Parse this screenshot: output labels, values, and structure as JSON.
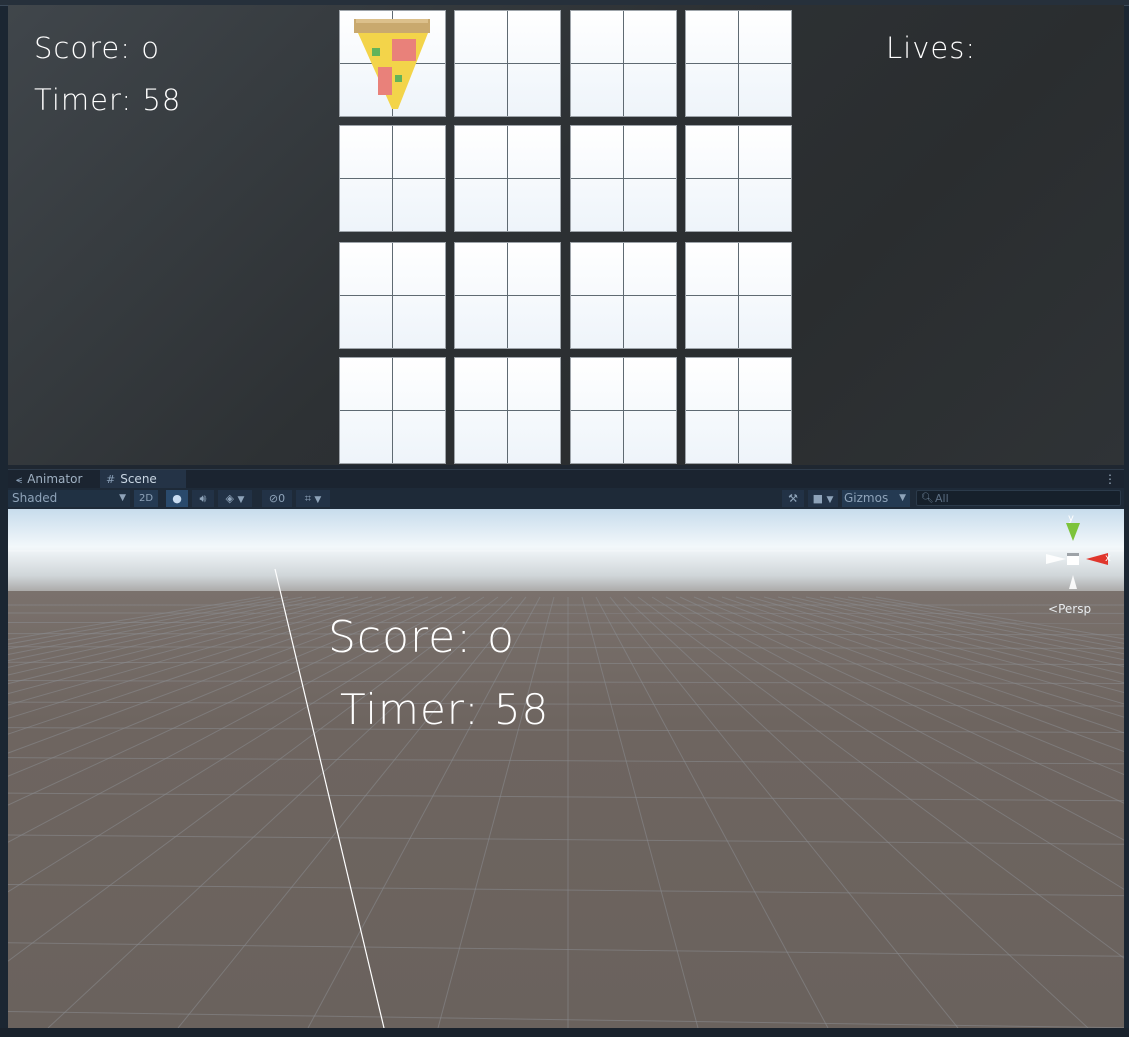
{
  "game_view": {
    "score_text": "Score: o",
    "timer_text": "Timer: 58",
    "lives_text": "Lives:",
    "cards": [
      {
        "row": 0,
        "col": 0,
        "face": "pizza-slice"
      },
      {
        "row": 0,
        "col": 1,
        "face": "blank"
      },
      {
        "row": 0,
        "col": 2,
        "face": "blank"
      },
      {
        "row": 0,
        "col": 3,
        "face": "blank"
      },
      {
        "row": 1,
        "col": 0,
        "face": "blank"
      },
      {
        "row": 1,
        "col": 1,
        "face": "blank"
      },
      {
        "row": 1,
        "col": 2,
        "face": "blank"
      },
      {
        "row": 1,
        "col": 3,
        "face": "blank"
      },
      {
        "row": 2,
        "col": 0,
        "face": "blank"
      },
      {
        "row": 2,
        "col": 1,
        "face": "blank"
      },
      {
        "row": 2,
        "col": 2,
        "face": "blank"
      },
      {
        "row": 2,
        "col": 3,
        "face": "blank"
      },
      {
        "row": 3,
        "col": 0,
        "face": "blank"
      },
      {
        "row": 3,
        "col": 1,
        "face": "blank"
      },
      {
        "row": 3,
        "col": 2,
        "face": "blank"
      },
      {
        "row": 3,
        "col": 3,
        "face": "blank"
      }
    ]
  },
  "tabs": [
    {
      "label": "Animator",
      "icon": "animator-icon"
    },
    {
      "label": "Scene",
      "icon": "scene-grid-icon",
      "active": true
    }
  ],
  "tab_menu_icon": "kebab-menu-icon",
  "toolbar": {
    "shading_mode": "Shaded",
    "two_d_label": "2D",
    "hidden_count": "0",
    "gizmos_label": "Gizmos",
    "search_placeholder": "All"
  },
  "scene_view": {
    "score_text": "Score: o",
    "timer_text": "Timer: 58",
    "gizmo": {
      "y_label": "y",
      "x_label": "x",
      "projection_label": "Persp"
    }
  },
  "colors": {
    "gizmo_y": "#7cc33b",
    "gizmo_x": "#e0362c",
    "gizmo_z": "#5a7fd0",
    "accent": "#2a4a6c"
  }
}
